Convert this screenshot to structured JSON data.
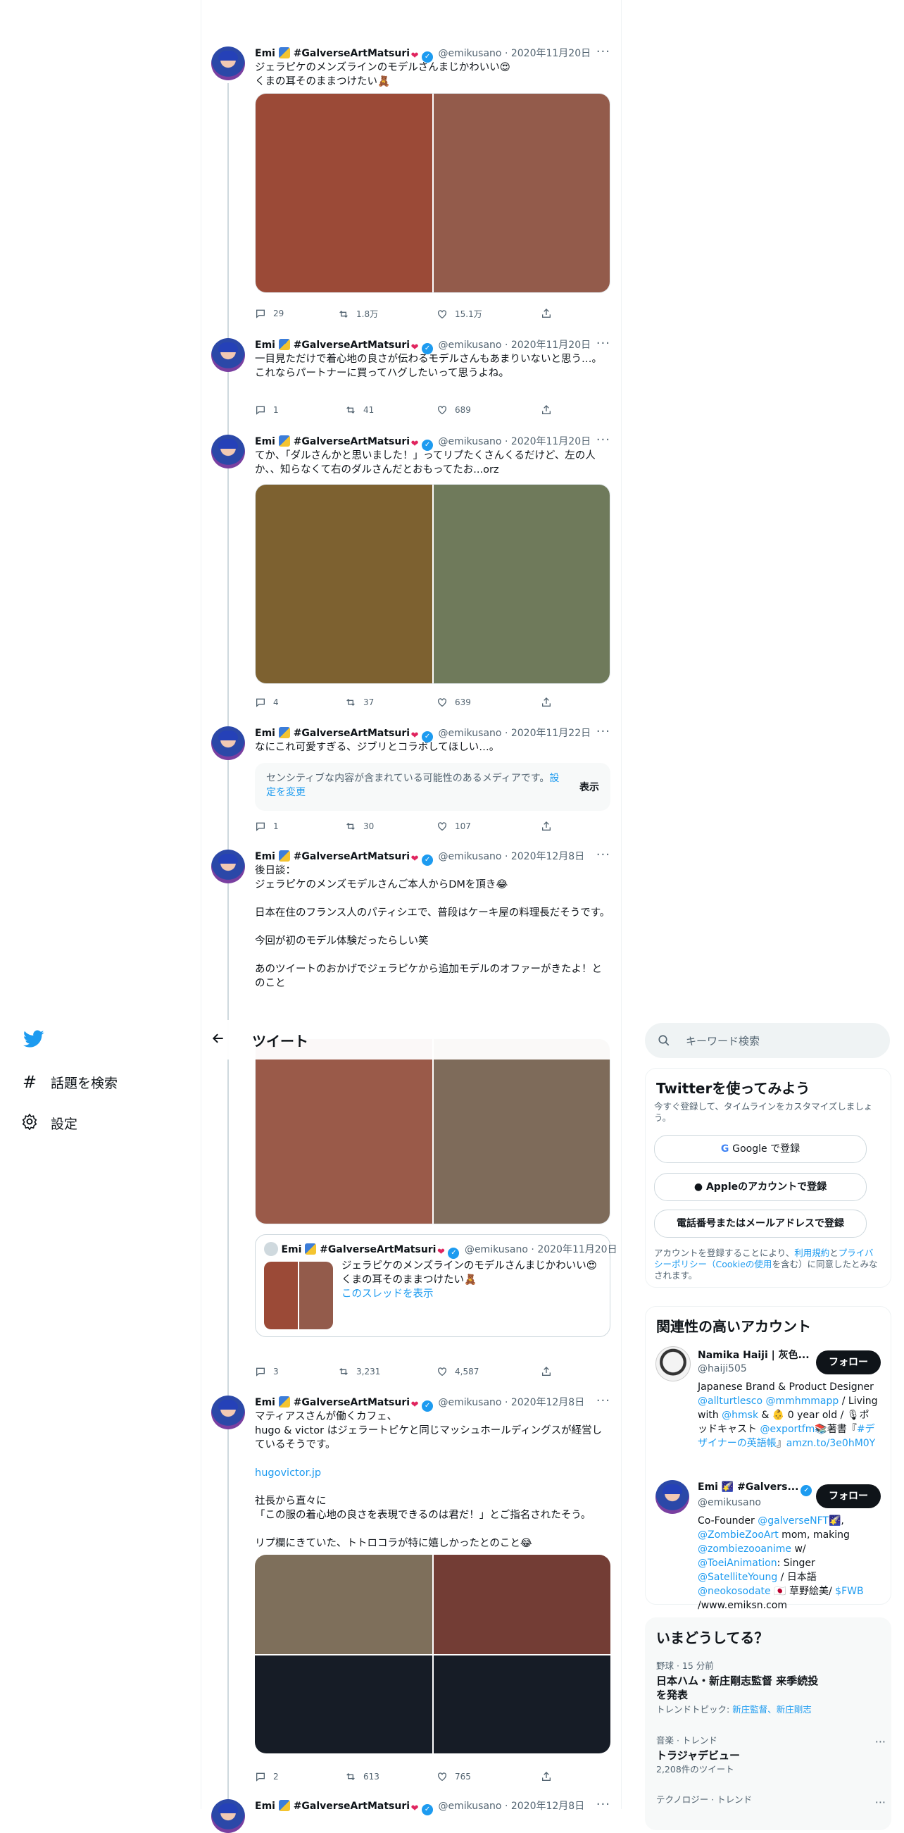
{
  "colors": {
    "accent": "#1d9bf0",
    "text": "#0f1419",
    "muted": "#536471"
  },
  "nav": {
    "items": [
      {
        "label": "話題を検索",
        "icon": "hash-icon"
      },
      {
        "label": "設定",
        "icon": "gear-icon"
      }
    ]
  },
  "header": {
    "title": "ツイート",
    "back_icon": "arrow-left-icon"
  },
  "author": {
    "name": "Emi",
    "tag": "#GalverseArtMatsuri",
    "handle": "@emikusano"
  },
  "tweets": [
    {
      "date": "2020年11月20日",
      "text": "ジェラピケのメンズラインのモデルさんまじかわいい😍\nくまの耳そのままつけたい🧸",
      "reply": "29",
      "retweet": "1.8万",
      "like": "15.1万"
    },
    {
      "date": "2020年11月20日",
      "text": "一目見ただけで着心地の良さが伝わるモデルさんもあまりいないと思う…。\nこれならパートナーに買ってハグしたいって思うよね。",
      "reply": "1",
      "retweet": "41",
      "like": "689"
    },
    {
      "date": "2020年11月20日",
      "text": "てか、「ダルさんかと思いました！」ってリプたくさんくるだけど、左の人か、、知らなくて右のダルさんだとおもってたお...orz",
      "reply": "4",
      "retweet": "37",
      "like": "639"
    },
    {
      "date": "2020年11月22日",
      "text": "なにこれ可愛すぎる、ジブリとコラボしてほしい…。",
      "reply": "1",
      "retweet": "30",
      "like": "107"
    },
    {
      "date": "2020年12月8日",
      "text": "後日談：\nジェラピケのメンズモデルさんご本人からDMを頂き😂\n\n日本在住のフランス人のパティシエで、普段はケーキ屋の料理長だそうです。\n\n今回が初のモデル体験だったらしい笑\n\nあのツイートのおかげでジェラピケから追加モデルのオファーがきたよ！とのこと",
      "reply": "3",
      "retweet": "3,231",
      "like": "4,587"
    },
    {
      "date": "2020年12月8日",
      "text": "マティアスさんが働くカフェ、\nhugo & victor はジェラートピケと同じマッシュホールディングスが経営しているそうです。",
      "link": "hugovictor.jp",
      "text2": "社長から直々に\n「この服の着心地の良さを表現できるのは君だ！」とご指名されたそう。\n\nリプ欄にきていた、トトロコラが特に嬉しかったとのこと😂",
      "reply": "2",
      "retweet": "613",
      "like": "765"
    },
    {
      "date": "2020年12月8日"
    }
  ],
  "quote": {
    "date": "2020年11月20日",
    "text": "ジェラピケのメンズラインのモデルさんまじかわいい😍\nくまの耳そのままつけたい🧸",
    "thread_link": "このスレッドを表示"
  },
  "sensitive": {
    "text": "センシティブな内容が含まれている可能性のあるメディアです。",
    "link": "設定を変更",
    "button": "表示"
  },
  "search": {
    "placeholder": "キーワード検索"
  },
  "signup": {
    "title": "Twitterを使ってみよう",
    "subtitle": "今すぐ登録して、タイムラインをカスタマイズしましょう。",
    "google": "Google で登録",
    "apple": "Appleのアカウントで登録",
    "phone": "電話番号またはメールアドレスで登録",
    "legal_pre": "アカウントを登録することにより、",
    "legal_terms": "利用規約",
    "legal_and": "と",
    "legal_privacy": "プライバシーポリシー（Cookieの使用",
    "legal_post": "を含む）に同意したとみなされます。"
  },
  "related": {
    "title": "関連性の高いアカウント",
    "follow": "フォロー",
    "accounts": [
      {
        "name": "Namika Haiji | 灰色...",
        "handle": "@haiji505",
        "bio_a": "Japanese Brand & Product Designer",
        "bio_b": "@allturtlesco @mmhmmapp",
        "bio_c": " / Living with ",
        "bio_d": "@hmsk",
        "bio_e": " & 👶 0 year old / 🎙ポッドキャスト ",
        "bio_f": "@exportfm",
        "bio_g": "📚著書『",
        "bio_h": "#デザイナーの英語帳",
        "bio_i": "』",
        "bio_j": "amzn.to/3e0hM0Y"
      },
      {
        "name": "Emi 🌠 #Galvers...",
        "handle": "@emikusano",
        "bio_a": "Co-Founder ",
        "bio_b": "@galverseNFT",
        "bio_c": "🌠, ",
        "bio_d": "@ZombieZooArt",
        "bio_e": " mom, making ",
        "bio_f": "@zombiezooanime",
        "bio_g": " w/ ",
        "bio_h": "@ToeiAnimation",
        "bio_i": ": Singer ",
        "bio_j": "@SatelliteYoung",
        "bio_k": " / 日本語 ",
        "bio_l": "@neokosodate",
        "bio_m": " 🇯🇵 草野絵美/ ",
        "bio_n": "$FWB",
        "bio_o": "/www.emiksn.com"
      }
    ]
  },
  "trends": {
    "title": "いまどうしてる？",
    "items": [
      {
        "meta": "野球 · 15 分前",
        "name": "日本ハム・新庄剛志監督 来季続投を発表",
        "topics_label": "トレンドトピック: ",
        "topics": "新庄監督、新庄剛志"
      },
      {
        "meta": "音楽 · トレンド",
        "name": "トラジャデビュー",
        "count": "2,208件のツイート"
      },
      {
        "meta": "テクノロジー · トレンド"
      }
    ]
  }
}
